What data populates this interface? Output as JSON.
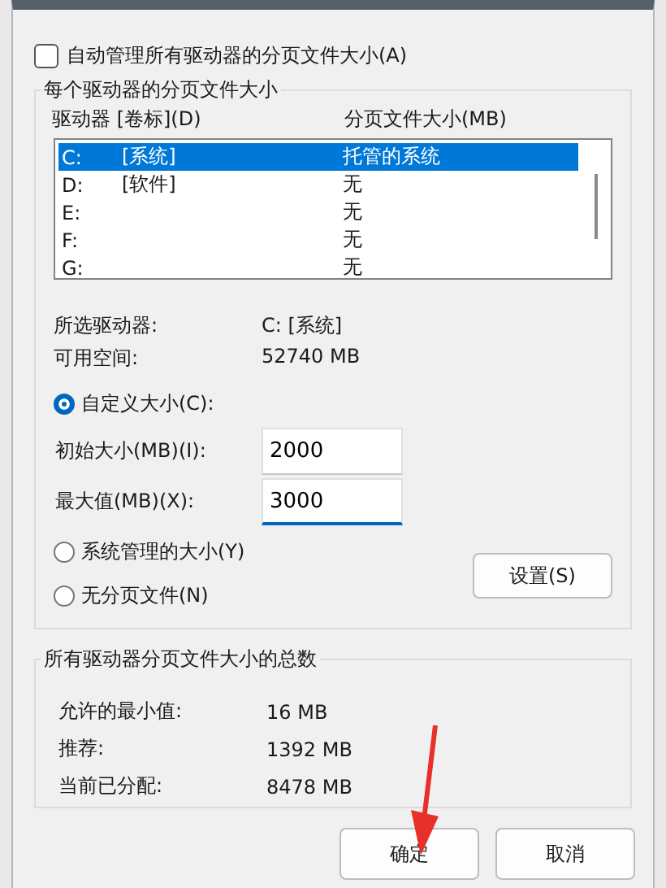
{
  "auto_manage": {
    "label": "自动管理所有驱动器的分页文件大小(A)",
    "checked": false
  },
  "per_drive": {
    "title": "每个驱动器的分页文件大小",
    "columns": [
      "驱动器 [卷标](D)",
      "分页文件大小(MB)"
    ],
    "rows": [
      {
        "drive": "C:",
        "volume": "[系统]",
        "size": "托管的系统",
        "selected": true
      },
      {
        "drive": "D:",
        "volume": "[软件]",
        "size": "无",
        "selected": false
      },
      {
        "drive": "E:",
        "size": "无",
        "selected": false
      },
      {
        "drive": "F:",
        "size": "无",
        "selected": false
      },
      {
        "drive": "G:",
        "size": "无",
        "selected": false
      }
    ],
    "info": [
      {
        "label": "所选驱动器:",
        "value": "C:  [系统]"
      },
      {
        "label": "可用空间:",
        "value": "52740 MB"
      }
    ],
    "custom_option": {
      "label": "自定义大小(C):",
      "selected": true
    },
    "fields": [
      {
        "label": "初始大小(MB)(I):",
        "value": "2000",
        "focused": false
      },
      {
        "label": "最大值(MB)(X):",
        "value": "3000",
        "focused": true
      }
    ],
    "other_options": [
      {
        "label": "系统管理的大小(Y)",
        "selected": false
      },
      {
        "label": "无分页文件(N)",
        "selected": false
      }
    ],
    "set_button": "设置(S)"
  },
  "totals": {
    "title": "所有驱动器分页文件大小的总数",
    "rows": [
      {
        "label": "允许的最小值:",
        "value": "16 MB"
      },
      {
        "label": "推荐:",
        "value": "1392 MB"
      },
      {
        "label": "当前已分配:",
        "value": "8478 MB"
      }
    ]
  },
  "buttons": [
    "确定",
    "取消"
  ]
}
